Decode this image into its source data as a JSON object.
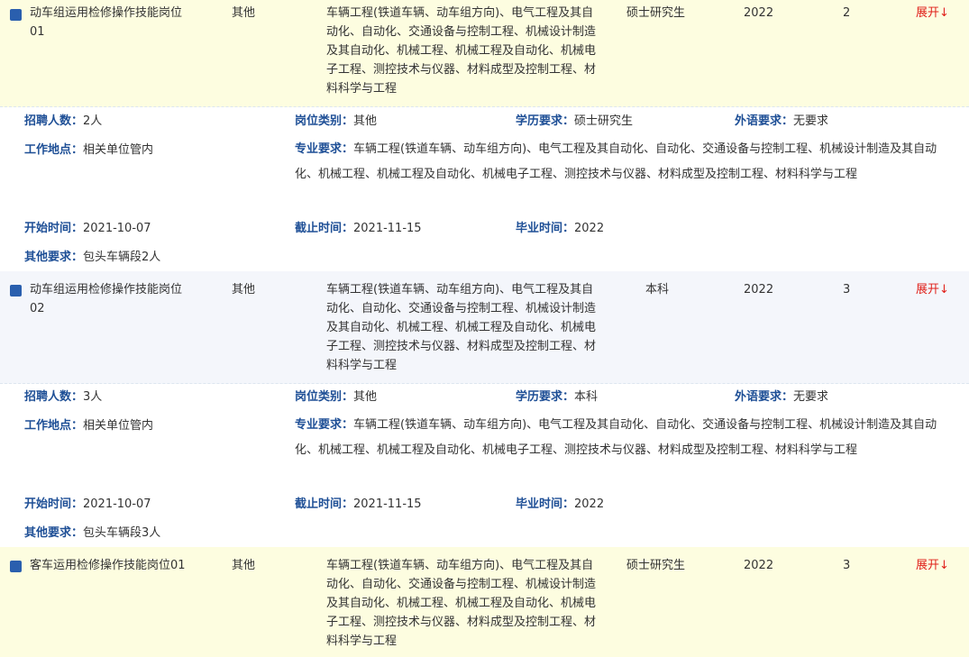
{
  "labels": {
    "recruit_count": "招聘人数：",
    "position_type": "岗位类别：",
    "education_req": "学历要求：",
    "language_req": "外语要求：",
    "work_location": "工作地点：",
    "major_req": "专业要求：",
    "start_time": "开始时间：",
    "end_time": "截止时间：",
    "graduation_time": "毕业时间：",
    "other_req": "其他要求："
  },
  "colors": {
    "marker_blue": "#2a5fae",
    "label_blue": "#1e4f96",
    "toggle_red": "#e0201a",
    "row_yellow": "#fdfde0",
    "row_gray": "#f4f6fb"
  },
  "icons": {
    "row_marker": "square-bullet-icon"
  },
  "positions": [
    {
      "name": "动车组运用检修操作技能岗位01",
      "category": "其他",
      "major_short": "车辆工程(铁道车辆、动车组方向)、电气工程及其自动化、自动化、交通设备与控制工程、机械设计制造及其自动化、机械工程、机械工程及自动化、机械电子工程、测控技术与仪器、材料成型及控制工程、材料科学与工程",
      "education": "硕士研究生",
      "year": "2022",
      "count": "2",
      "toggle": "展开↓",
      "detail": {
        "recruit_count": "2人",
        "position_type": "其他",
        "education_req": "硕士研究生",
        "language_req": "无要求",
        "work_location": "相关单位管内",
        "major_req": "车辆工程(铁道车辆、动车组方向)、电气工程及其自动化、自动化、交通设备与控制工程、机械设计制造及其自动化、机械工程、机械工程及自动化、机械电子工程、测控技术与仪器、材料成型及控制工程、材料科学与工程",
        "start_time": "2021-10-07",
        "end_time": "2021-11-15",
        "graduation_time": "2022",
        "other_req": "包头车辆段2人"
      }
    },
    {
      "name": "动车组运用检修操作技能岗位02",
      "category": "其他",
      "major_short": "车辆工程(铁道车辆、动车组方向)、电气工程及其自动化、自动化、交通设备与控制工程、机械设计制造及其自动化、机械工程、机械工程及自动化、机械电子工程、测控技术与仪器、材料成型及控制工程、材料科学与工程",
      "education": "本科",
      "year": "2022",
      "count": "3",
      "toggle": "展开↓",
      "detail": {
        "recruit_count": "3人",
        "position_type": "其他",
        "education_req": "本科",
        "language_req": "无要求",
        "work_location": "相关单位管内",
        "major_req": "车辆工程(铁道车辆、动车组方向)、电气工程及其自动化、自动化、交通设备与控制工程、机械设计制造及其自动化、机械工程、机械工程及自动化、机械电子工程、测控技术与仪器、材料成型及控制工程、材料科学与工程",
        "start_time": "2021-10-07",
        "end_time": "2021-11-15",
        "graduation_time": "2022",
        "other_req": "包头车辆段3人"
      }
    },
    {
      "name": "客车运用检修操作技能岗位01",
      "category": "其他",
      "major_short": "车辆工程(铁道车辆、动车组方向)、电气工程及其自动化、自动化、交通设备与控制工程、机械设计制造及其自动化、机械工程、机械工程及自动化、机械电子工程、测控技术与仪器、材料成型及控制工程、材料科学与工程",
      "education": "硕士研究生",
      "year": "2022",
      "count": "3",
      "toggle": "展开↓"
    }
  ]
}
